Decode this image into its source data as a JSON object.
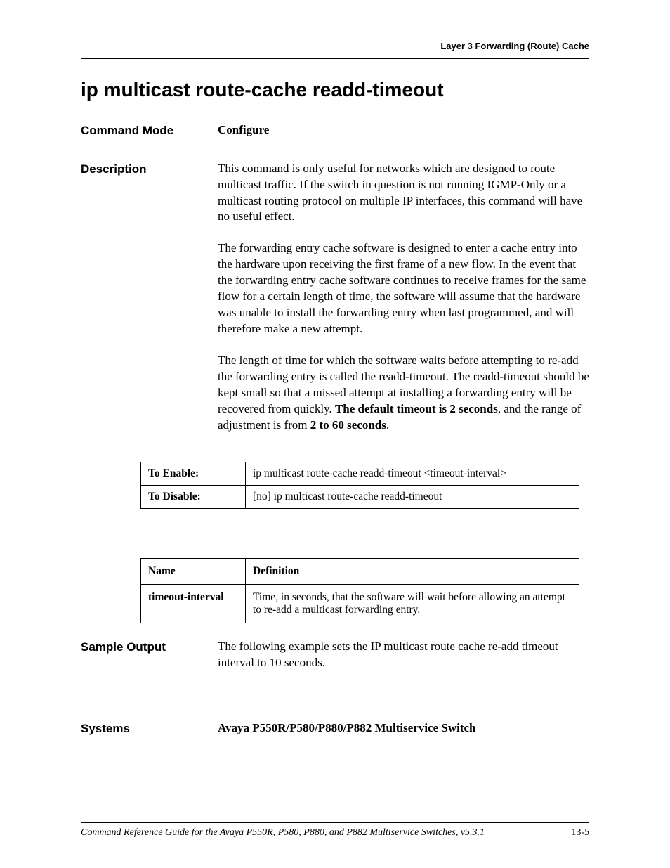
{
  "running_header": "Layer 3 Forwarding (Route) Cache",
  "title": "ip multicast route-cache readd-timeout",
  "labels": {
    "command_mode": "Command Mode",
    "description": "Description",
    "sample_output": "Sample Output",
    "systems": "Systems"
  },
  "command_mode_value": "Configure",
  "description": {
    "p1": "This command is only useful for networks which are designed to route multicast traffic. If the switch in question is not running IGMP-Only or a multicast routing protocol on multiple IP interfaces, this command will have no useful effect.",
    "p2": "The forwarding entry cache software is designed to enter a cache entry into the hardware upon receiving the first frame of a new flow. In the event that the forwarding entry cache software continues to receive frames for the same flow for a certain length of time, the software will assume that the hardware was unable to install the forwarding entry when last programmed, and will therefore make a new attempt.",
    "p3a": "The length of time for which the software waits before attempting to re-add the forwarding entry is called the readd-timeout. The readd-timeout should be kept small so that a missed attempt at installing a forwarding entry will be recovered from quickly. ",
    "p3b": "The default timeout is 2 seconds",
    "p3c": ", and the range of adjustment is from ",
    "p3d": "2 to 60 seconds",
    "p3e": "."
  },
  "enable_table": {
    "r1_key": "To Enable:",
    "r1_val": "ip multicast route-cache readd-timeout <timeout-interval>",
    "r2_key": "To Disable:",
    "r2_val": "[no] ip multicast route-cache readd-timeout"
  },
  "def_table": {
    "h1": "Name",
    "h2": "Definition",
    "r1_name": "timeout-interval",
    "r1_def": "Time, in seconds, that the software will wait before allowing an attempt to re-add a multicast forwarding entry."
  },
  "sample_output": "The following example sets the IP multicast route cache re-add timeout interval to 10 seconds.",
  "systems_value": "Avaya P550R/P580/P880/P882 Multiservice Switch",
  "footer_text": "Command Reference Guide for the Avaya P550R, P580, P880, and P882 Multiservice Switches, v5.3.1",
  "page_number": "13-5"
}
